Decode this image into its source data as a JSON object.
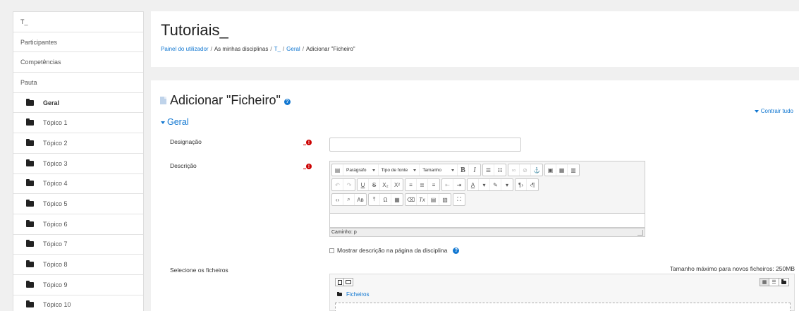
{
  "sidebar": {
    "items": [
      {
        "label": "T_"
      },
      {
        "label": "Participantes"
      },
      {
        "label": "Competências"
      },
      {
        "label": "Pauta"
      },
      {
        "label": "Geral"
      },
      {
        "label": "Tópico 1"
      },
      {
        "label": "Tópico 2"
      },
      {
        "label": "Tópico 3"
      },
      {
        "label": "Tópico 4"
      },
      {
        "label": "Tópico 5"
      },
      {
        "label": "Tópico 6"
      },
      {
        "label": "Tópico 7"
      },
      {
        "label": "Tópico 8"
      },
      {
        "label": "Tópico 9"
      },
      {
        "label": "Tópico 10"
      }
    ]
  },
  "header": {
    "title": "Tutoriais_",
    "breadcrumb": [
      {
        "label": "Painel do utilizador",
        "link": true
      },
      {
        "label": "As minhas disciplinas",
        "link": false
      },
      {
        "label": "T_",
        "link": true
      },
      {
        "label": "Geral",
        "link": true
      },
      {
        "label": "Adicionar \"Ficheiro\"",
        "link": false
      }
    ],
    "separator": "/"
  },
  "form": {
    "title": "Adicionar \"Ficheiro\"",
    "help_glyph": "?",
    "collapse_all": "Contrair tudo",
    "section_legend": "Geral",
    "name_label": "Designação",
    "description_label": "Descrição",
    "required_glyph": "!",
    "editor": {
      "paragraph_select": "Parágrafo",
      "font_family_select": "Tipo de fonte",
      "font_size_select": "Tamanho",
      "status_path": "Caminho: p"
    },
    "show_description_label": "Mostrar descrição na página da disciplina",
    "files_label": "Selecione os ficheiros",
    "max_size_text": "Tamanho máximo para novos ficheiros: 250MB",
    "files_path": "Ficheiros"
  },
  "colors": {
    "link": "#1177d1",
    "required": "#cc0000",
    "background": "#f0f0f0"
  }
}
